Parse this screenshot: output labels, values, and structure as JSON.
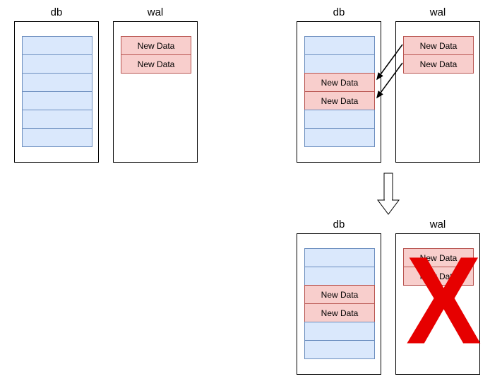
{
  "diagram": {
    "stage1": {
      "db": {
        "title": "db"
      },
      "wal": {
        "title": "wal",
        "entries": [
          "New Data",
          "New Data"
        ]
      }
    },
    "stage2": {
      "db": {
        "title": "db",
        "entries": [
          "New Data",
          "New Data"
        ]
      },
      "wal": {
        "title": "wal",
        "entries": [
          "New Data",
          "New Data"
        ]
      }
    },
    "stage3": {
      "db": {
        "title": "db",
        "entries": [
          "New Data",
          "New Data"
        ]
      },
      "wal": {
        "title": "wal",
        "entries": [
          "New Data",
          "New Data"
        ]
      }
    }
  }
}
